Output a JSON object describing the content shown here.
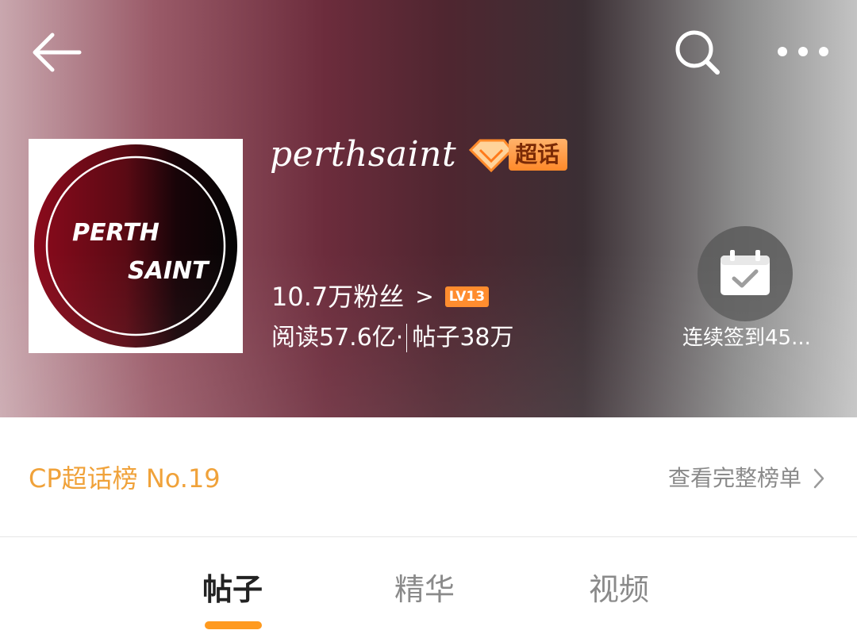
{
  "header": {
    "title": "perthsaint",
    "badge_label": "超话",
    "fans_text": "10.7万粉丝",
    "fans_arrow": ">",
    "level": "LV13",
    "stats_read": "阅读57.6亿·",
    "stats_posts": "帖子38万",
    "checkin_label": "连续签到45..."
  },
  "avatar": {
    "line1": "PERTH",
    "line2": "SAINT"
  },
  "ranking": {
    "left_text": "CP超话榜 No.19",
    "right_text": "查看完整榜单"
  },
  "tabs": [
    {
      "label": "帖子",
      "active": true
    },
    {
      "label": "精华",
      "active": false
    },
    {
      "label": "视频",
      "active": false
    }
  ],
  "colors": {
    "accent": "#ff9a1f",
    "rank_text": "#f0a23a",
    "badge": "#ff8a2a"
  },
  "icons": {
    "back": "arrow-left-icon",
    "search": "search-icon",
    "more": "more-dots-icon",
    "checkin": "calendar-check-icon",
    "chevron": "chevron-right-icon",
    "badge": "diamond-icon"
  }
}
